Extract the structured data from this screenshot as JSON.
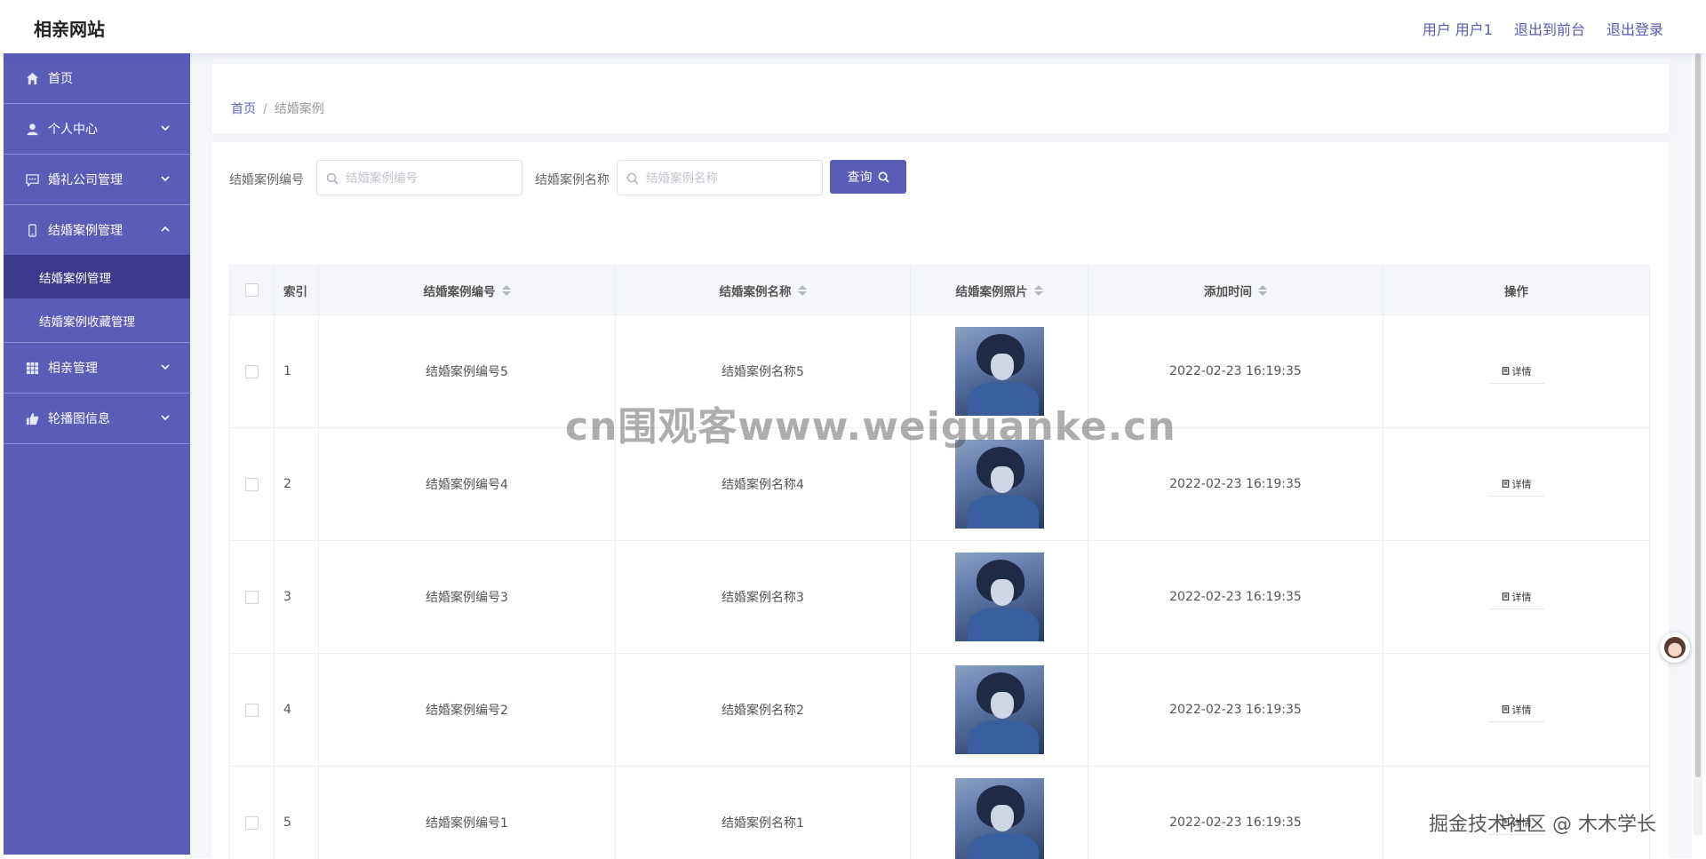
{
  "header": {
    "site_title": "相亲网站",
    "user_label": "用户 用户1",
    "to_front": "退出到前台",
    "logout": "退出登录"
  },
  "sidebar": {
    "items": [
      {
        "label": "首页",
        "icon": "home-icon"
      },
      {
        "label": "个人中心",
        "icon": "user-icon"
      },
      {
        "label": "婚礼公司管理",
        "icon": "chat-icon"
      },
      {
        "label": "结婚案例管理",
        "icon": "phone-icon"
      },
      {
        "label": "相亲管理",
        "icon": "grid-icon"
      },
      {
        "label": "轮播图信息",
        "icon": "thumb-icon"
      }
    ],
    "sub_items": [
      {
        "label": "结婚案例管理",
        "active": true
      },
      {
        "label": "结婚案例收藏管理",
        "active": false
      }
    ]
  },
  "breadcrumb": {
    "home": "首页",
    "separator": "/",
    "current": "结婚案例"
  },
  "search": {
    "no_label": "结婚案例编号",
    "no_placeholder": "结婚案例编号",
    "name_label": "结婚案例名称",
    "name_placeholder": "结婚案例名称",
    "button": "查询"
  },
  "table": {
    "headers": {
      "index": "索引",
      "no": "结婚案例编号",
      "name": "结婚案例名称",
      "photo": "结婚案例照片",
      "time": "添加时间",
      "op": "操作"
    },
    "rows": [
      {
        "index": "1",
        "no": "结婚案例编号5",
        "name": "结婚案例名称5",
        "time": "2022-02-23 16:19:35",
        "action": "详情"
      },
      {
        "index": "2",
        "no": "结婚案例编号4",
        "name": "结婚案例名称4",
        "time": "2022-02-23 16:19:35",
        "action": "详情"
      },
      {
        "index": "3",
        "no": "结婚案例编号3",
        "name": "结婚案例名称3",
        "time": "2022-02-23 16:19:35",
        "action": "详情"
      },
      {
        "index": "4",
        "no": "结婚案例编号2",
        "name": "结婚案例名称2",
        "time": "2022-02-23 16:19:35",
        "action": "详情"
      },
      {
        "index": "5",
        "no": "结婚案例编号1",
        "name": "结婚案例名称1",
        "time": "2022-02-23 16:19:35",
        "action": "详情"
      }
    ]
  },
  "overlay": {
    "watermark": "cn围观客www.weiguanke.cn",
    "credit": "掘金技术社区 @ 木木学长"
  },
  "colors": {
    "accent": "#5b5bb8",
    "active_sub": "#3d3a8c"
  }
}
